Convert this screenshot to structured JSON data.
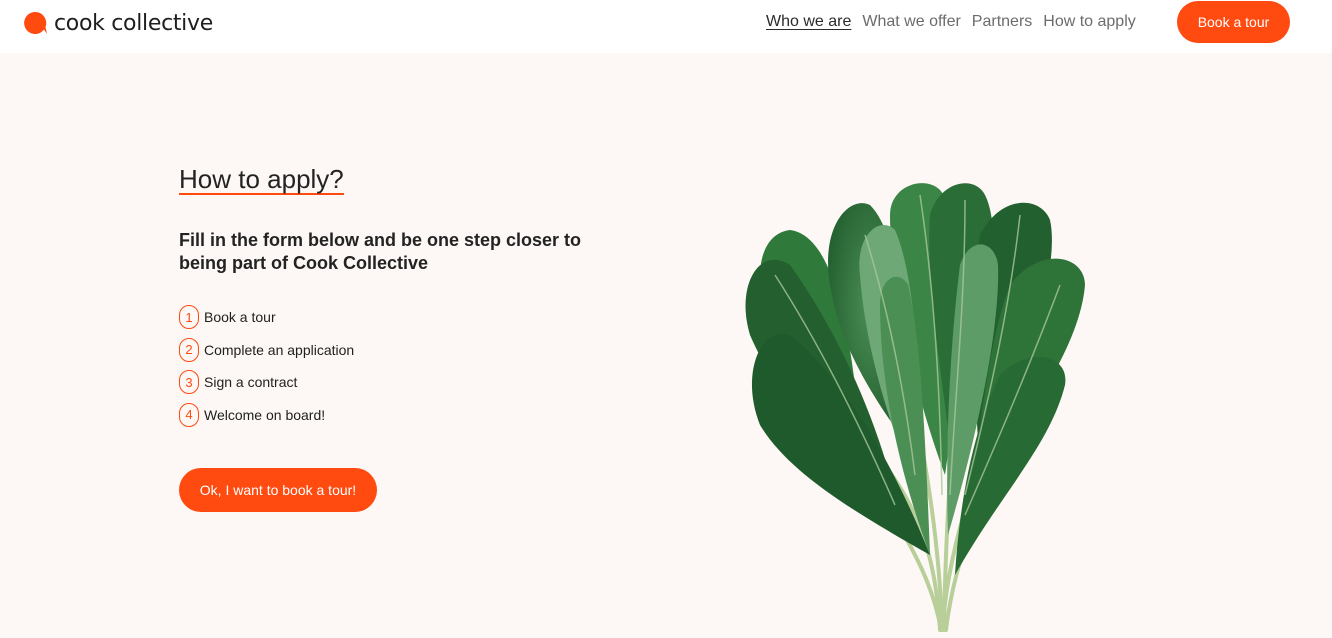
{
  "header": {
    "logo_text": "cook collective",
    "nav": [
      {
        "label": "Who we are",
        "active": true
      },
      {
        "label": "What we offer"
      },
      {
        "label": "Partners"
      },
      {
        "label": "How to apply"
      }
    ],
    "book_button": "Book a tour"
  },
  "main": {
    "heading": "How to apply?",
    "subheading": "Fill in the form below and be one step closer to being part of Cook Collective",
    "steps": [
      {
        "num": "1",
        "label": "Book a tour"
      },
      {
        "num": "2",
        "label": "Complete an application"
      },
      {
        "num": "3",
        "label": "Sign a contract"
      },
      {
        "num": "4",
        "label": "Welcome on board!"
      }
    ],
    "cta": "Ok, I want to book a tour!"
  },
  "colors": {
    "accent": "#ff4a10",
    "background": "#fdf8f5",
    "header": "#ffffff",
    "leaf_dark": "#1f5a2c",
    "leaf_mid": "#2e7a3c",
    "leaf_light": "#6fa877"
  },
  "icons": {
    "logo": "speech-bubble-icon"
  }
}
